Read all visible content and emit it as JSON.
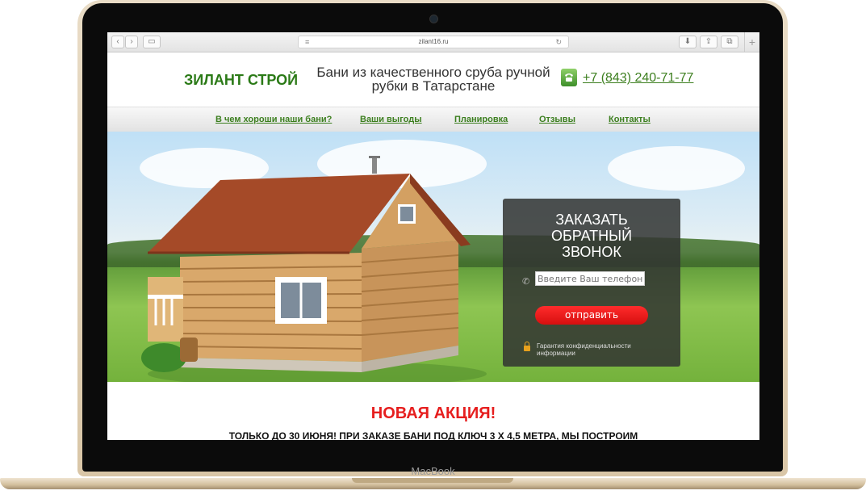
{
  "device": {
    "brand": "MacBook"
  },
  "browser": {
    "url": "zilant16.ru"
  },
  "site": {
    "logo": "ЗИЛАНТ СТРОЙ",
    "tagline": "Бани из качественного сруба ручной рубки в Татарстане",
    "phone": "+7 (843) 240-71-77"
  },
  "nav": {
    "items": [
      {
        "label": "В чем хороши наши бани?"
      },
      {
        "label": "Ваши выгоды"
      },
      {
        "label": "Планировка"
      },
      {
        "label": "Отзывы"
      },
      {
        "label": "Контакты"
      }
    ]
  },
  "callback_form": {
    "title_line1": "ЗАКАЗАТЬ",
    "title_line2": "ОБРАТНЫЙ",
    "title_line3": "ЗВОНОК",
    "phone_placeholder": "Введите Ваш телефон",
    "submit_label": "отправить",
    "privacy_note": "Гарантия конфиденциальности информации"
  },
  "promo": {
    "title": "НОВАЯ АКЦИЯ!",
    "subtitle": "ТОЛЬКО ДО 30 ИЮНЯ! ПРИ ЗАКАЗЕ БАНИ ПОД КЛЮЧ 3 Х 4,5 МЕТРА, МЫ ПОСТРОИМ"
  },
  "colors": {
    "brand_green": "#2b7a17",
    "accent_red": "#e61e1e",
    "laptop_gold": "#d9c6a7"
  }
}
